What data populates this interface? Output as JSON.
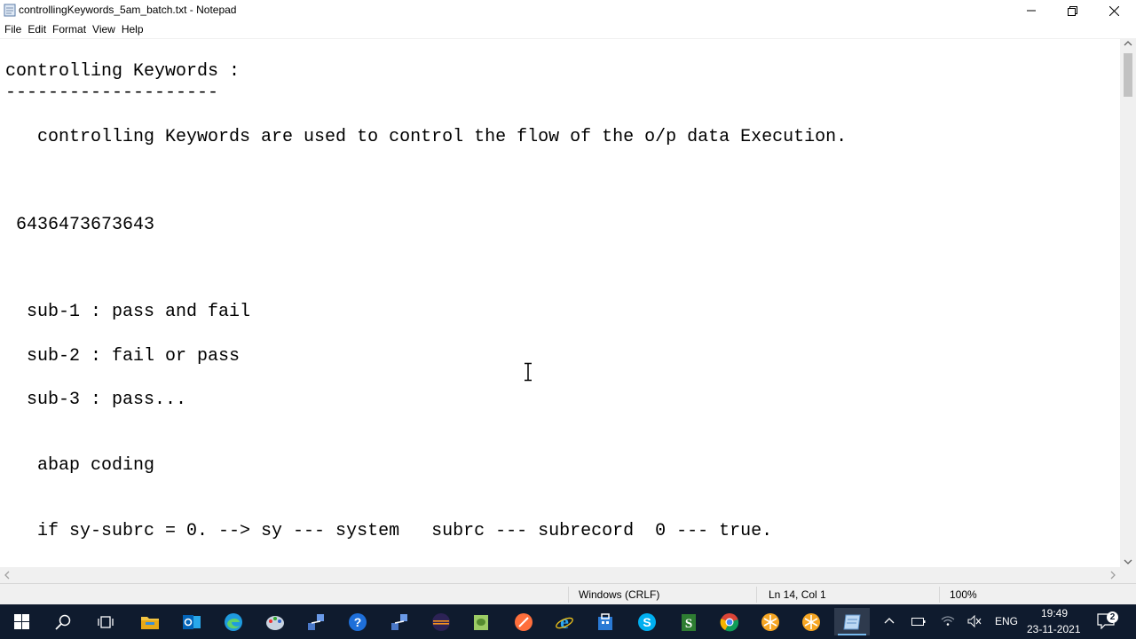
{
  "window": {
    "title": "controllingKeywords_5am_batch.txt - Notepad"
  },
  "menu": {
    "items": [
      "File",
      "Edit",
      "Format",
      "View",
      "Help"
    ]
  },
  "editor": {
    "lines": [
      "controlling Keywords :",
      "--------------------",
      "   controlling Keywords are used to control the flow of the o/p data Execution.",
      " 6436473673643",
      "  sub-1 : pass and fail",
      "  sub-2 : fail or pass",
      "  sub-3 : pass...",
      "   abap coding",
      "   if sy-subrc = 0. --> sy --- system   subrc --- subrecord  0 --- true."
    ]
  },
  "statusbar": {
    "line_ending": "Windows (CRLF)",
    "position": "Ln 14, Col 1",
    "zoom": "100%"
  },
  "taskbar": {
    "icons": [
      "windows-start-icon",
      "search-icon",
      "task-view-icon",
      "file-explorer-icon",
      "outlook-icon",
      "edge-icon",
      "paint-app-icon",
      "network-tool-icon",
      "help-icon",
      "network-tool-2-icon",
      "eclipse-icon",
      "notepad-plus-icon",
      "sublime-icon",
      "ie-icon",
      "store-app-icon",
      "skype-icon",
      "scripting-icon",
      "chrome-icon",
      "snowflake-app-icon",
      "snowflake-app-2-icon",
      "notepad-icon"
    ],
    "tray": {
      "language": "ENG",
      "time": "19:49",
      "date": "23-11-2021",
      "notification_count": "2"
    }
  }
}
